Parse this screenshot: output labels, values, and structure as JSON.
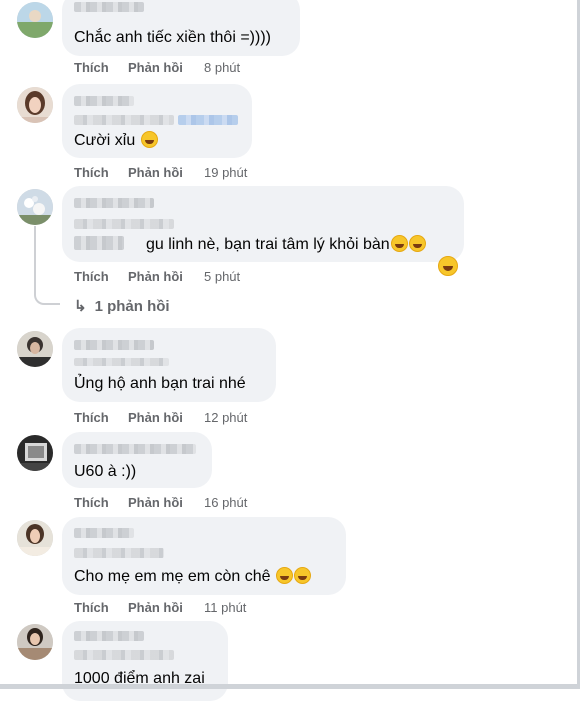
{
  "comments": [
    {
      "text": "Chắc anh tiếc xiền thôi =))))",
      "emojis": 0,
      "like": "Thích",
      "reply": "Phản hồi",
      "time": "8 phút"
    },
    {
      "text": "Cười xỉu",
      "emojis": 1,
      "like": "Thích",
      "reply": "Phản hồi",
      "time": "19 phút"
    },
    {
      "text": "gu linh nè, bạn trai tâm lý khỏi bàn",
      "emojis": 3,
      "like": "Thích",
      "reply": "Phản hồi",
      "time": "5 phút"
    },
    {
      "text": "Ủng hộ anh bạn trai nhé",
      "emojis": 0,
      "like": "Thích",
      "reply": "Phản hồi",
      "time": "12 phút"
    },
    {
      "text": "U60 à :))",
      "emojis": 0,
      "like": "Thích",
      "reply": "Phản hồi",
      "time": "16 phút"
    },
    {
      "text": "Cho mẹ em mẹ em còn chê",
      "emojis": 2,
      "like": "Thích",
      "reply": "Phản hồi",
      "time": "11 phút"
    },
    {
      "text": "1000 điểm anh zai",
      "emojis": 0
    }
  ],
  "replies_link": "1 phản hồi",
  "replies_arrow": "↳",
  "colors": {
    "bubble": "#f0f2f5",
    "meta": "#65676b",
    "text": "#050505",
    "emoji": "#f7c62a"
  }
}
